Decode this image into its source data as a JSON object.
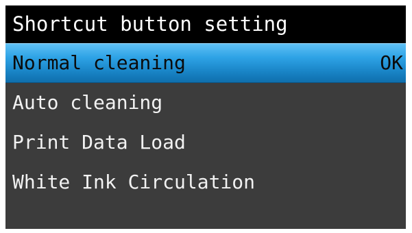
{
  "title": "Shortcut button setting",
  "menu": {
    "items": [
      {
        "label": "Normal cleaning",
        "value": "OK"
      },
      {
        "label": "Auto cleaning"
      },
      {
        "label": "Print Data Load"
      },
      {
        "label": "White Ink Circulation"
      }
    ]
  },
  "colors": {
    "title_bg": "#000000",
    "screen_bg": "#3c3c3c",
    "selected_highlight": "#2ea3e6",
    "text": "#f2f2f2"
  }
}
